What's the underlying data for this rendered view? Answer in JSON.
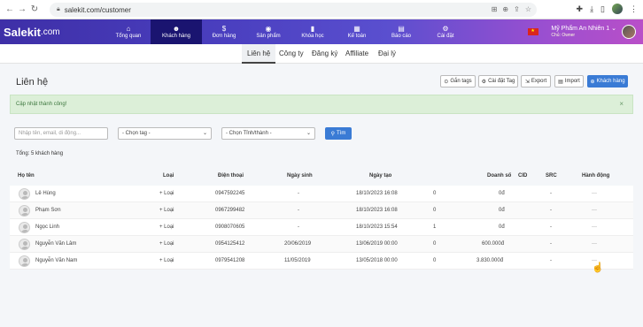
{
  "browser": {
    "url": "salekit.com/customer"
  },
  "app": {
    "logo_main": "Salekit",
    "logo_suffix": ".com",
    "nav": [
      {
        "label": "Tổng quan",
        "icon": "home-icon",
        "glyph": "⌂"
      },
      {
        "label": "Khách hàng",
        "icon": "users-icon",
        "glyph": "☻"
      },
      {
        "label": "Đơn hàng",
        "icon": "dollar-icon",
        "glyph": "$"
      },
      {
        "label": "Sản phẩm",
        "icon": "product-icon",
        "glyph": "◉"
      },
      {
        "label": "Khóa học",
        "icon": "book-icon",
        "glyph": "▮"
      },
      {
        "label": "Kế toán",
        "icon": "calculator-icon",
        "glyph": "▦"
      },
      {
        "label": "Báo cáo",
        "icon": "report-icon",
        "glyph": "▤"
      },
      {
        "label": "Cài đặt",
        "icon": "gear-icon",
        "glyph": "⚙"
      }
    ],
    "user_name": "Mỹ Phẩm An Nhiên 1",
    "user_role": "Chủ: Owner"
  },
  "subtabs": [
    "Liên hệ",
    "Công ty",
    "Đăng ký",
    "Affiliate",
    "Đại lý"
  ],
  "page_title": "Liên hệ",
  "actions": {
    "tag": "Gắn tags",
    "tag_settings": "Cài đặt Tag",
    "export": "Export",
    "import": "Import",
    "add_customer": "Khách hàng"
  },
  "alert": "Cập nhật thành công!",
  "filters": {
    "search_placeholder": "Nhập tên, email, di động...",
    "tag_select": "- Chọn tag -",
    "province_select": "- Chọn Tỉnh/thành -",
    "search_button": "Tìm"
  },
  "total_text": "Tổng: 5 khách hàng",
  "table": {
    "headers": [
      "Họ tên",
      "Loại",
      "Điện thoại",
      "Ngày sinh",
      "Ngày tạo",
      "Doanh số",
      "CID",
      "SRC",
      "Hành động"
    ],
    "rows": [
      {
        "name": "Lê Hùng",
        "type": "+ Loại",
        "phone": "0947592245",
        "dob": "-",
        "created": "18/10/2023 16:08",
        "count": "0",
        "revenue": "0đ",
        "src": "-",
        "action": "···"
      },
      {
        "name": "Phạm Sơn",
        "type": "+ Loại",
        "phone": "0967299482",
        "dob": "-",
        "created": "18/10/2023 16:08",
        "count": "0",
        "revenue": "0đ",
        "src": "-",
        "action": "···"
      },
      {
        "name": "Ngọc Linh",
        "type": "+ Loại",
        "phone": "0908070605",
        "dob": "-",
        "created": "18/10/2023 15:54",
        "count": "1",
        "revenue": "0đ",
        "src": "-",
        "action": "···"
      },
      {
        "name": "Nguyễn Văn Lâm",
        "type": "+ Loại",
        "phone": "0954125412",
        "dob": "20/06/2019",
        "created": "13/06/2019 00:00",
        "count": "0",
        "revenue": "600.000đ",
        "src": "-",
        "action": "···"
      },
      {
        "name": "Nguyễn Văn Nam",
        "type": "+ Loại",
        "phone": "0979541208",
        "dob": "11/05/2019",
        "created": "13/05/2018 00:00",
        "count": "0",
        "revenue": "3.830.000đ",
        "src": "-",
        "action": "···"
      }
    ]
  }
}
